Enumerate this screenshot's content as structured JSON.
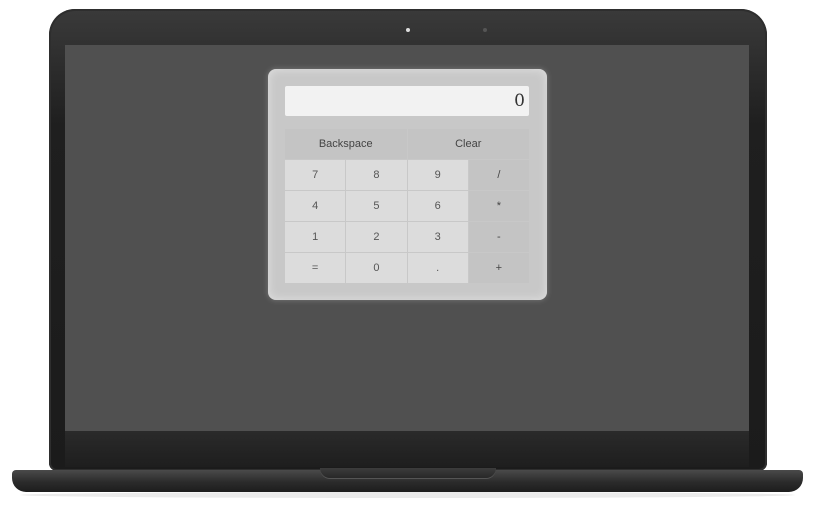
{
  "calculator": {
    "display_value": "0",
    "keys": {
      "backspace": "Backspace",
      "clear": "Clear",
      "seven": "7",
      "eight": "8",
      "nine": "9",
      "divide": "/",
      "four": "4",
      "five": "5",
      "six": "6",
      "multiply": "*",
      "one": "1",
      "two": "2",
      "three": "3",
      "subtract": "-",
      "equals": "=",
      "zero": "0",
      "decimal": ".",
      "add": "+"
    }
  }
}
